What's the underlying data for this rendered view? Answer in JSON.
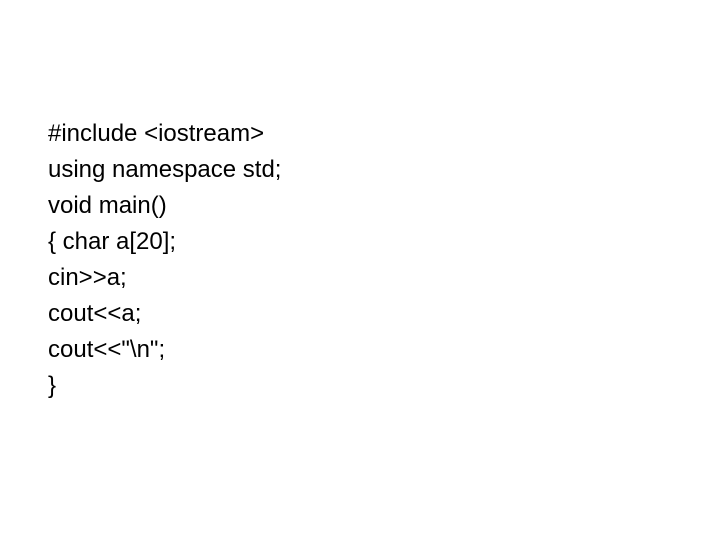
{
  "code": {
    "line1": "#include <iostream>",
    "line2": "using namespace std;",
    "line3": "void main()",
    "line4": "{ char a[20];",
    "line5": "cin>>a;",
    "line6": "cout<<a;",
    "line7": "cout<<\"\\n\";",
    "line8": "}"
  }
}
